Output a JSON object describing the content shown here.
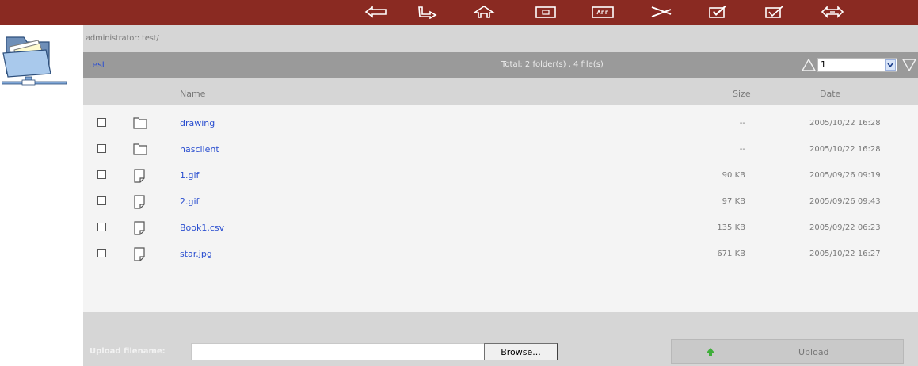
{
  "toolbar": {
    "buttons": [
      {
        "icon": "back-arrow-icon"
      },
      {
        "icon": "forward-path-icon"
      },
      {
        "icon": "home-icon"
      },
      {
        "icon": "new-folder-icon"
      },
      {
        "icon": "rename-icon"
      },
      {
        "icon": "cut-icon"
      },
      {
        "icon": "check-select-icon"
      },
      {
        "icon": "check-unselect-icon"
      },
      {
        "icon": "refresh-arrows-icon"
      }
    ]
  },
  "path": "administrator: test/",
  "header": {
    "folder": "test",
    "total": "Total: 2 folder(s) , 4 file(s)",
    "page": "1"
  },
  "columns": {
    "name": "Name",
    "size": "Size",
    "date": "Date"
  },
  "rows": [
    {
      "type": "folder",
      "name": "drawing",
      "size": "--",
      "date": "2005/10/22 16:28"
    },
    {
      "type": "folder",
      "name": "nasclient",
      "size": "--",
      "date": "2005/10/22 16:28"
    },
    {
      "type": "file",
      "name": "1.gif",
      "size": "90 KB",
      "date": "2005/09/26 09:19"
    },
    {
      "type": "file",
      "name": "2.gif",
      "size": "97 KB",
      "date": "2005/09/26 09:43"
    },
    {
      "type": "file",
      "name": "Book1.csv",
      "size": "135 KB",
      "date": "2005/09/22 06:23"
    },
    {
      "type": "file",
      "name": "star.jpg",
      "size": "671 KB",
      "date": "2005/10/22 16:27"
    }
  ],
  "upload": {
    "label": "Upload filename:",
    "value": "",
    "browse": "Browse...",
    "button": "Upload"
  },
  "colors": {
    "toolbar": "#8a2a22",
    "link": "#2b4fd0",
    "header": "#9a9a9a",
    "panel": "#d6d6d6",
    "list": "#f4f4f4"
  }
}
